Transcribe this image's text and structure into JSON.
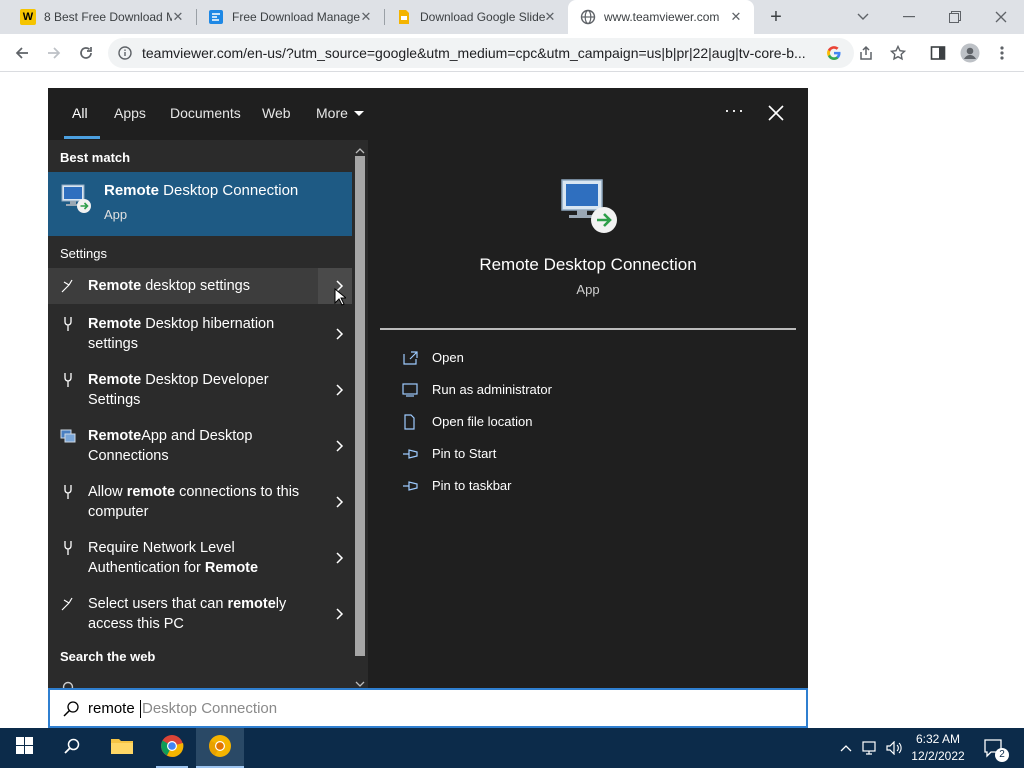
{
  "browser": {
    "tabs": [
      {
        "title": "8 Best Free Download M",
        "favicon": "w-icon"
      },
      {
        "title": "Free Download Manage",
        "favicon": "fdm-icon"
      },
      {
        "title": "Download Google Slide",
        "favicon": "slides-icon"
      },
      {
        "title": "www.teamviewer.com",
        "favicon": "globe-icon"
      }
    ],
    "url": "teamviewer.com/en-us/?utm_source=google&utm_medium=cpc&utm_campaign=us|b|pr|22|aug|tv-core-b..."
  },
  "search": {
    "tabs": [
      "All",
      "Apps",
      "Documents",
      "Web",
      "More"
    ],
    "active_tab": "All",
    "more_options": "···",
    "best_match_heading": "Best match",
    "best_match": {
      "bold": "Remote",
      "rest": " Desktop Connection",
      "type": "App"
    },
    "settings_heading": "Settings",
    "settings_items": [
      {
        "pre": "",
        "bold": "Remote",
        "post": " desktop settings"
      },
      {
        "pre": "",
        "bold": "Remote",
        "post": " Desktop hibernation settings"
      },
      {
        "pre": "",
        "bold": "Remote",
        "post": " Desktop Developer Settings"
      },
      {
        "pre": "",
        "bold": "Remote",
        "post": "App and Desktop Connections"
      },
      {
        "pre": "Allow ",
        "bold": "remote",
        "post": " connections to this computer"
      },
      {
        "pre": "Require Network Level Authentication for ",
        "bold": "Remote",
        "post": ""
      },
      {
        "pre": "Select users that can ",
        "bold": "remote",
        "post": "ly access this PC"
      }
    ],
    "web_heading": "Search the web",
    "preview": {
      "title": "Remote Desktop Connection",
      "subtitle": "App",
      "actions": [
        "Open",
        "Run as administrator",
        "Open file location",
        "Pin to Start",
        "Pin to taskbar"
      ]
    },
    "query_typed": "remote",
    "query_suggestion": "Desktop Connection"
  },
  "taskbar": {
    "time": "6:32 AM",
    "date": "12/2/2022",
    "notification_count": "2"
  },
  "colors": {
    "panel_bg": "#1f1f1f",
    "list_bg": "#2b2b2b",
    "selected_bg": "#1e5a84",
    "accent": "#4ca0e0",
    "taskbar_bg": "#0c2b4a"
  }
}
